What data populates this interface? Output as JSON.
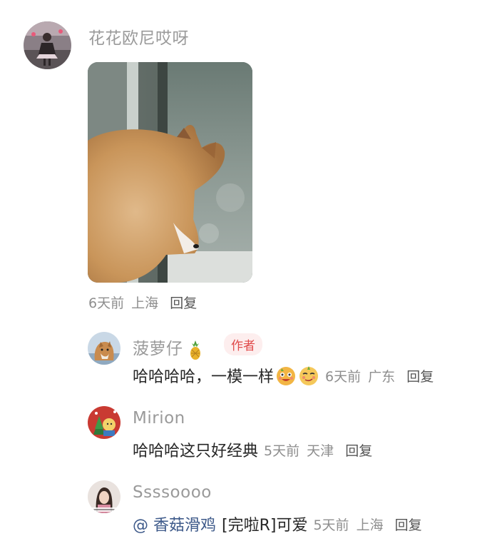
{
  "comment1": {
    "username": "花花欧尼哎呀",
    "time": "6天前",
    "location": "上海",
    "reply_label": "回复"
  },
  "reply1": {
    "username": "菠萝仔",
    "badge": "作者",
    "text": "哈哈哈哈，一模一样",
    "time": "6天前",
    "location": "广东",
    "reply_label": "回复",
    "emoji_names": [
      "smiling-face-sticker",
      "sly-face-sticker"
    ],
    "username_icon": "pineapple-icon"
  },
  "reply2": {
    "username": "Mirion",
    "text": "哈哈哈这只好经典",
    "time": "5天前",
    "location": "天津",
    "reply_label": "回复"
  },
  "reply3": {
    "username": "Ssssoooo",
    "mention": "@ 香菇滑鸡",
    "sticker_text": "[完啦R]可爱",
    "time": "5天前",
    "location": "上海",
    "reply_label": "回复"
  },
  "colors": {
    "username": "#9a9a9a",
    "meta": "#8e8e8e",
    "badge_bg": "#fdeeee",
    "badge_text": "#e04a4a",
    "mention": "#3e5a8a"
  }
}
